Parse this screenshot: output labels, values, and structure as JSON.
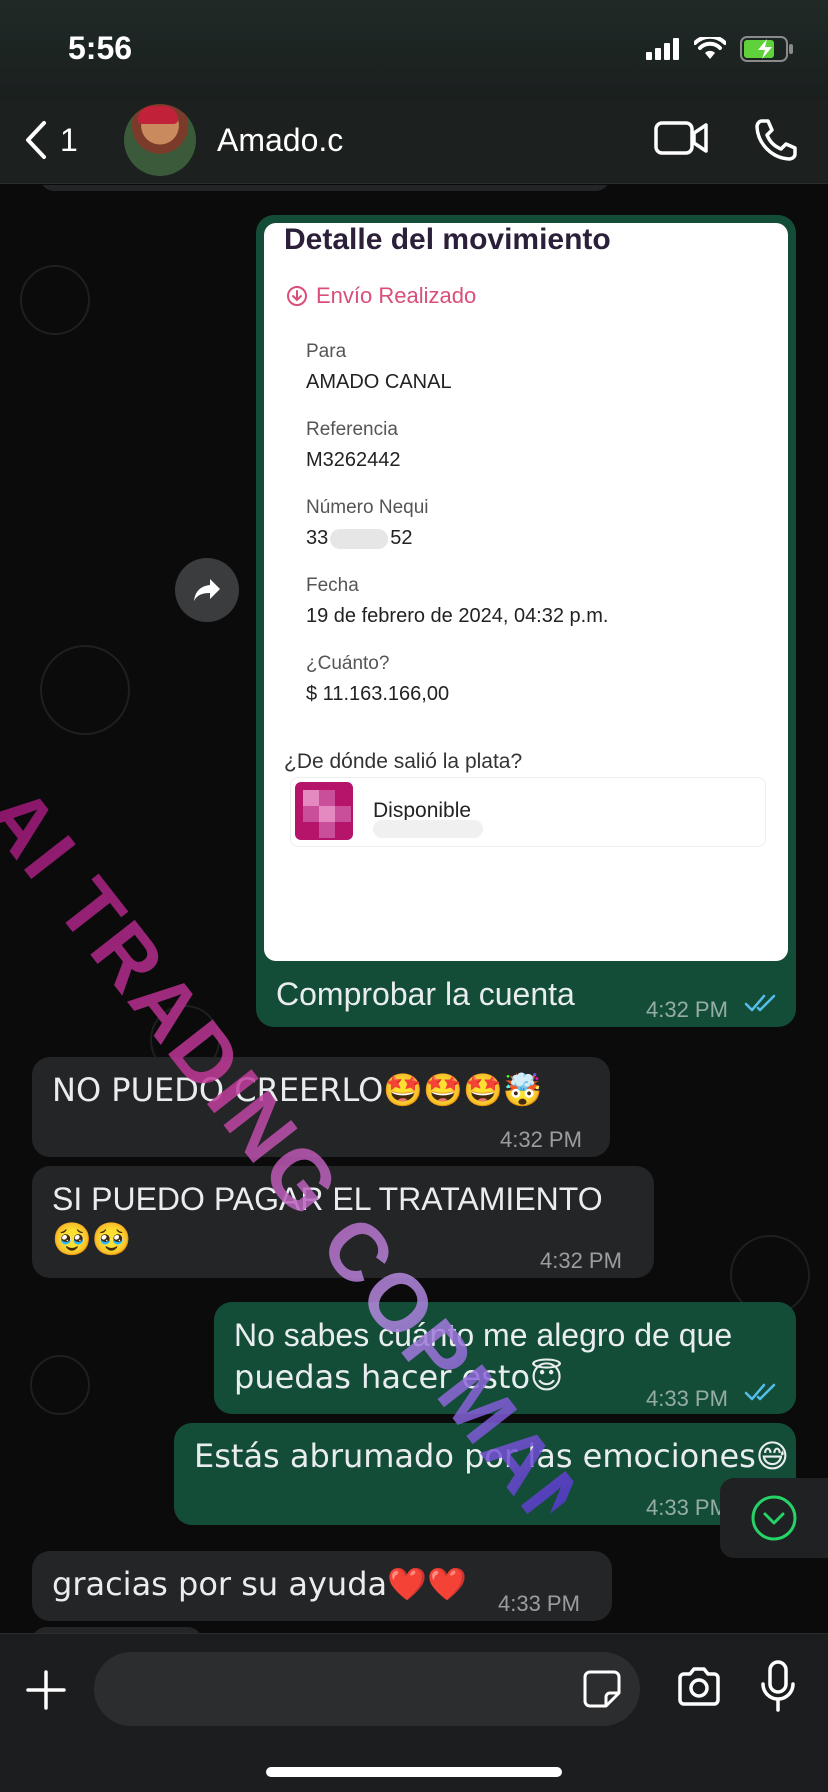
{
  "status_bar": {
    "time": "5:56",
    "battery_color": "#5fd13a"
  },
  "header": {
    "back_count": "1",
    "contact_name": "Amado.c",
    "icons": [
      "chevron-left-icon",
      "video-camera-icon",
      "phone-icon"
    ]
  },
  "receipt": {
    "title": "Detalle del movimiento",
    "status": "Envío Realizado",
    "fields": [
      {
        "label": "Para",
        "value": "AMADO CANAL"
      },
      {
        "label": "Referencia",
        "value": "M3262442"
      },
      {
        "label": "Número Nequi",
        "value_prefix": "33",
        "value_suffix": "52"
      },
      {
        "label": "Fecha",
        "value": "19 de febrero de 2024, 04:32 p.m."
      },
      {
        "label": "¿Cuánto?",
        "value": "$ 11.163.166,00"
      }
    ],
    "source_question": "¿De dónde salió la plata?",
    "source_account": "Disponible"
  },
  "messages": [
    {
      "dir": "out",
      "text": "Comprobar la cuenta",
      "time": "4:32 PM",
      "read": true
    },
    {
      "dir": "in",
      "text": "NO PUEDO CREERLO🤩🤩🤩🤯",
      "time": "4:32 PM"
    },
    {
      "dir": "in",
      "text": "SI PUEDO PAGAR EL TRATAMIENTO",
      "text2": "🥹🥹",
      "time": "4:32 PM"
    },
    {
      "dir": "out",
      "text": "No sabes cuánto me alegro de que",
      "text2": "puedas hacer esto😇",
      "time": "4:33 PM",
      "read": true
    },
    {
      "dir": "out",
      "text": "Estás abrumado por las emociones😅",
      "time": "4:33 PM"
    },
    {
      "dir": "in",
      "text": "gracias por su ayuda❤️❤️",
      "time": "4:33 PM"
    }
  ],
  "watermark": "AI TRADING COPMANY",
  "composer": {
    "placeholder": ""
  },
  "colors": {
    "outgoing": "#144d37",
    "incoming": "#232526",
    "read_ticks": "#53bdeb",
    "accent": "#25d366"
  }
}
